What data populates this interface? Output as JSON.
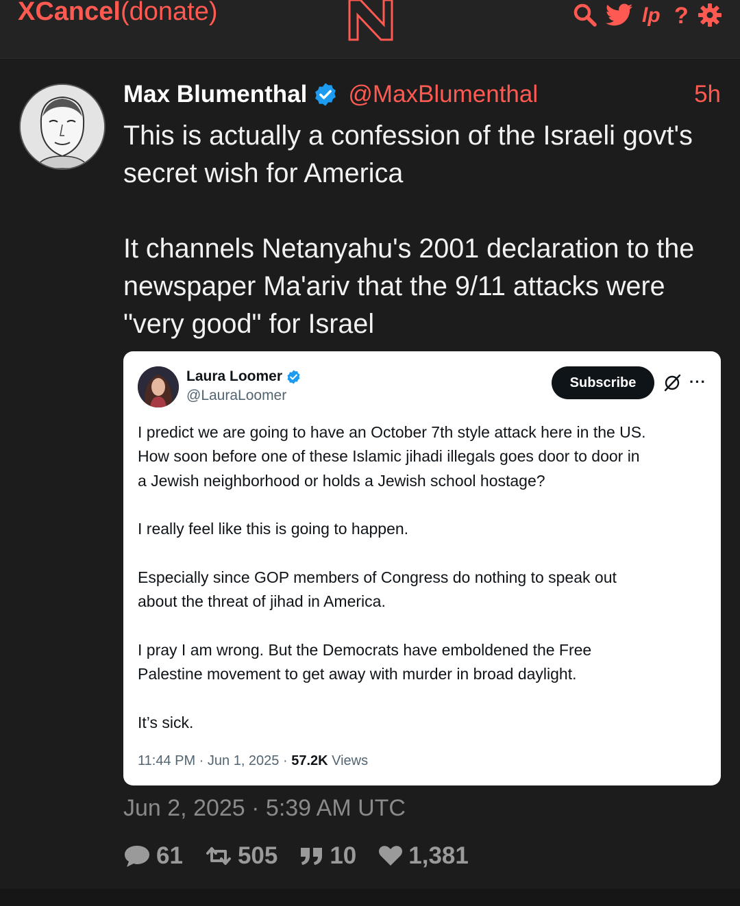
{
  "site": {
    "brand": "XCancel",
    "suffix": "(donate)",
    "logo_letter": "N",
    "accent_color": "#ff5a52",
    "nav_icons": [
      "search-icon",
      "twitter-bird-icon",
      "liberapay-icon",
      "help-icon",
      "settings-icon"
    ],
    "help_glyph": "?"
  },
  "tweet": {
    "author_name": "Max Blumenthal",
    "handle": "@MaxBlumenthal",
    "time_ago": "5h",
    "paragraphs": [
      "This is actually a confession of the Israeli govt's secret wish for America",
      "It channels Netanyahu's 2001 declaration to the newspaper Ma'ariv that the 9/11 attacks were \"very good\" for Israel"
    ],
    "date": "Jun 2, 2025 · 5:39 AM UTC",
    "stats": {
      "replies": "61",
      "retweets": "505",
      "quotes": "10",
      "likes": "1,381"
    }
  },
  "quoted_screenshot": {
    "author_name": "Laura Loomer",
    "handle": "@LauraLoomer",
    "subscribe_label": "Subscribe",
    "more_glyph": "···",
    "paragraphs": [
      "I predict we are going to have an October 7th style attack here in the US.\nHow soon before one of these Islamic jihadi illegals goes door to door in\na Jewish neighborhood or holds a Jewish school hostage?",
      "I really feel like this is going to happen.",
      "Especially since GOP members of Congress do nothing to speak out\nabout the threat of jihad in America.",
      "I pray I am wrong. But the Democrats have emboldened the Free\nPalestine movement to get away with murder in broad daylight.",
      "It’s sick."
    ],
    "meta_time": "11:44 PM · Jun 1, 2025 · ",
    "views_count": "57.2K",
    "views_label": " Views"
  }
}
